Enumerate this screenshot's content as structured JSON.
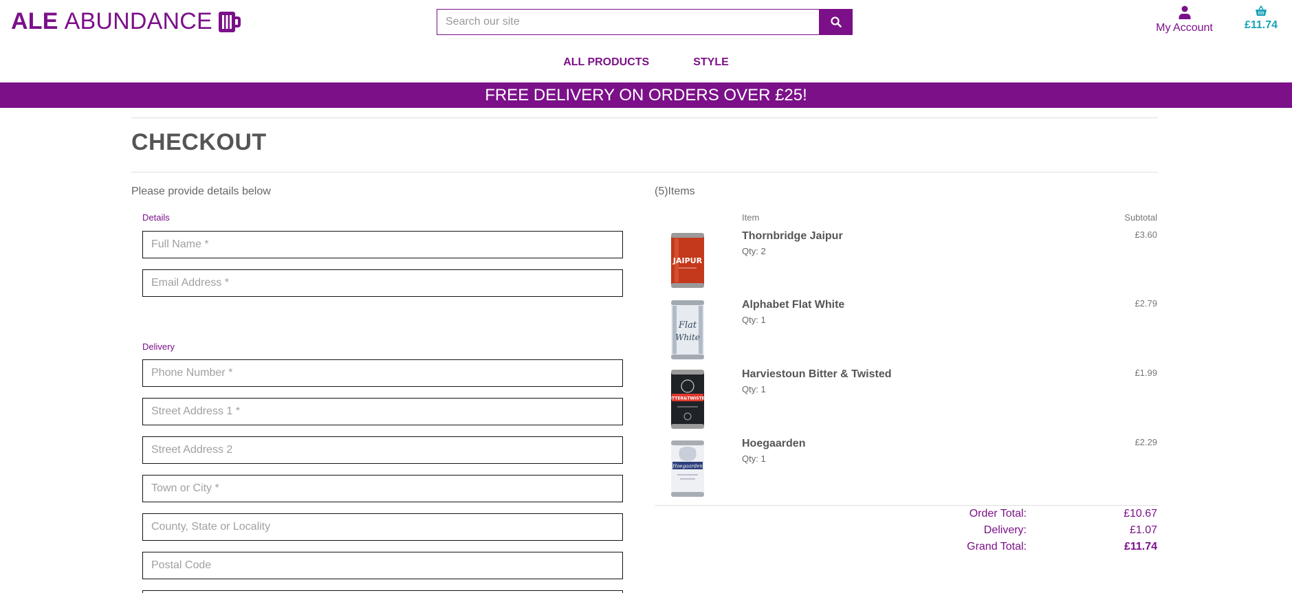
{
  "brand": {
    "bold": "ALE",
    "light": "ABUNDANCE",
    "color": "#7b1089"
  },
  "search": {
    "placeholder": "Search our site"
  },
  "account": {
    "label": "My Account"
  },
  "basket": {
    "total": "£11.74"
  },
  "nav": {
    "all_products": "ALL PRODUCTS",
    "style": "STYLE"
  },
  "banner": {
    "text": "FREE DELIVERY ON ORDERS OVER £25!"
  },
  "checkout": {
    "title": "CHECKOUT",
    "intro": "Please provide details below",
    "details_legend": "Details",
    "delivery_legend": "Delivery",
    "fields": {
      "full_name": "Full Name *",
      "email": "Email Address *",
      "phone": "Phone Number *",
      "street1": "Street Address 1 *",
      "street2": "Street Address 2",
      "town": "Town or City *",
      "county": "County, State or Locality",
      "postcode": "Postal Code"
    }
  },
  "summary": {
    "count_label": "(5)Items",
    "item_header": "Item",
    "subtotal_header": "Subtotal",
    "items": [
      {
        "name": "Thornbridge Jaipur",
        "qty": "Qty: 2",
        "subtotal": "£3.60",
        "image": "jaipur-can"
      },
      {
        "name": "Alphabet Flat White",
        "qty": "Qty: 1",
        "subtotal": "£2.79",
        "image": "flat-white-can"
      },
      {
        "name": "Harviestoun Bitter & Twisted",
        "qty": "Qty: 1",
        "subtotal": "£1.99",
        "image": "bitter-twisted-can"
      },
      {
        "name": "Hoegaarden",
        "qty": "Qty: 1",
        "subtotal": "£2.29",
        "image": "hoegaarden-can"
      }
    ],
    "order_total_label": "Order Total:",
    "order_total": "£10.67",
    "delivery_label": "Delivery:",
    "delivery": "£1.07",
    "grand_total_label": "Grand Total:",
    "grand_total": "£11.74"
  }
}
